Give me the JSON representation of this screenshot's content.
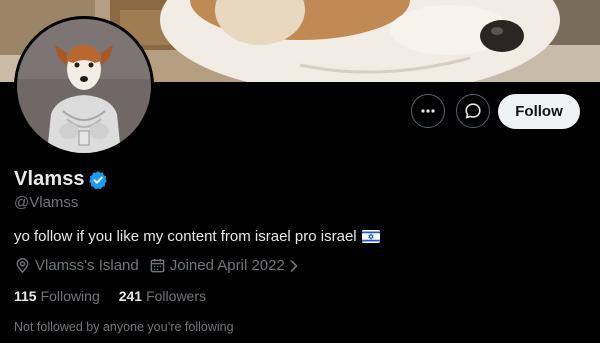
{
  "profile": {
    "display_name": "Vlamss",
    "handle": "@Vlamss",
    "bio": "yo follow if you like my content from israel pro israel",
    "location": "Vlamss's Island",
    "joined": "Joined April 2022",
    "following_count": "115",
    "following_label": "Following",
    "followers_count": "241",
    "followers_label": "Followers",
    "not_followed_text": "Not followed by anyone you’re following"
  },
  "actions": {
    "follow_label": "Follow",
    "more_icon": "ellipsis-icon",
    "message_icon": "message-bubble-icon"
  },
  "icons": {
    "verified": "verified-badge-icon",
    "location": "location-pin-icon",
    "calendar": "calendar-icon",
    "flag": "israel-flag-emoji"
  },
  "colors": {
    "background": "#000000",
    "primary_text": "#e7e9ea",
    "secondary_text": "#71767b",
    "verified_blue": "#1d9bf0",
    "follow_button_bg": "#eff3f4",
    "button_border": "#536471"
  }
}
